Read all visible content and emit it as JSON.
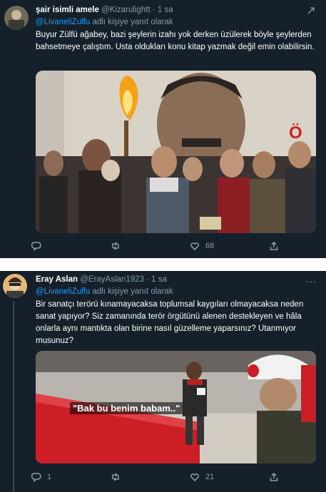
{
  "tweets": [
    {
      "author_name": "şair isimli amele",
      "handle": "@Kizarulightt",
      "separator": "·",
      "time": "1 sa",
      "reply_mention": "@LivaneliZulfu",
      "reply_suffix": "adlı kişiye yanıt olarak",
      "text": "Buyur Zülfü ağabey, bazi şeylerin izahı yok derken üzülerek böyle şeylerden bahsetmeye çalıştım. Usta oldukları konu kitap yazmak değil emin olabilirsin.",
      "media_icon": "person-portrait-with-torch-photo",
      "reply_count": "",
      "retweet_count": "",
      "like_count": "68"
    },
    {
      "author_name": "Eray Aslan",
      "handle": "@ErayAslan1923",
      "separator": "·",
      "time": "1 sa",
      "reply_mention": "@LivaneliZulfu",
      "reply_suffix": "adlı kişiye yanıt olarak",
      "text": "Bir sanatçı terörü kınamayacaksa toplumsal kaygıları olmayacaksa neden sanat yapıyor? Siz zamanında terör örgütünü alenen destekleyen ve hâla onlarla aynı mantıkta olan birine nasıl güzelleme yaparsınız? Utanmıyor musunuz?",
      "media_caption": "\"Bak bu benim babam..\"",
      "reply_count": "1",
      "retweet_count": "",
      "like_count": "21"
    }
  ],
  "colors": {
    "background": "#15202b",
    "accent": "#1d9bf0",
    "secondary_text": "#8899a6"
  }
}
